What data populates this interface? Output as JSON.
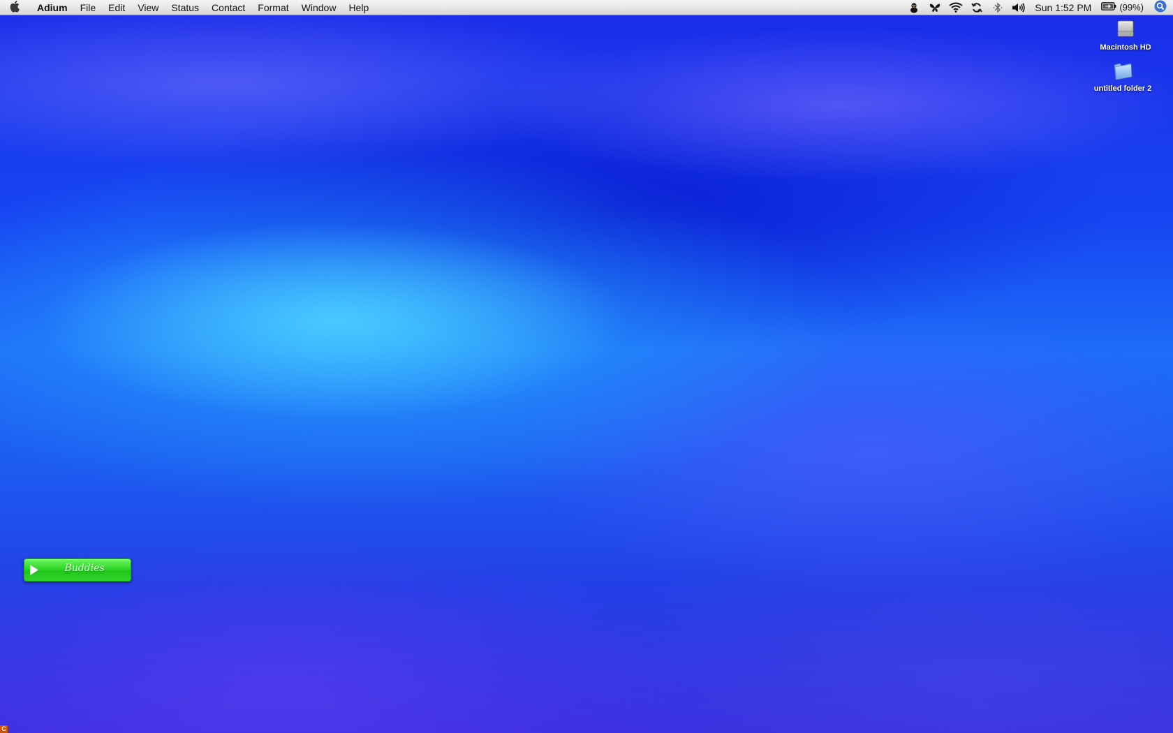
{
  "menubar": {
    "app_name": "Adium",
    "menus": [
      "File",
      "Edit",
      "View",
      "Status",
      "Contact",
      "Format",
      "Window",
      "Help"
    ],
    "status_icons": [
      "adium-duck-icon",
      "growl-butterfly-icon",
      "wifi-icon",
      "sync-icon",
      "bluetooth-icon",
      "volume-icon"
    ],
    "clock": "Sun 1:52 PM",
    "battery": "(99%)"
  },
  "desktop": {
    "icons": [
      {
        "label": "Macintosh HD",
        "icon": "hard-drive-icon"
      },
      {
        "label": "untitled folder 2",
        "icon": "folder-icon"
      }
    ]
  },
  "buddy_list": {
    "title": "Buddies",
    "color": "#2fd629"
  },
  "dock_corner": {
    "label": "C"
  }
}
